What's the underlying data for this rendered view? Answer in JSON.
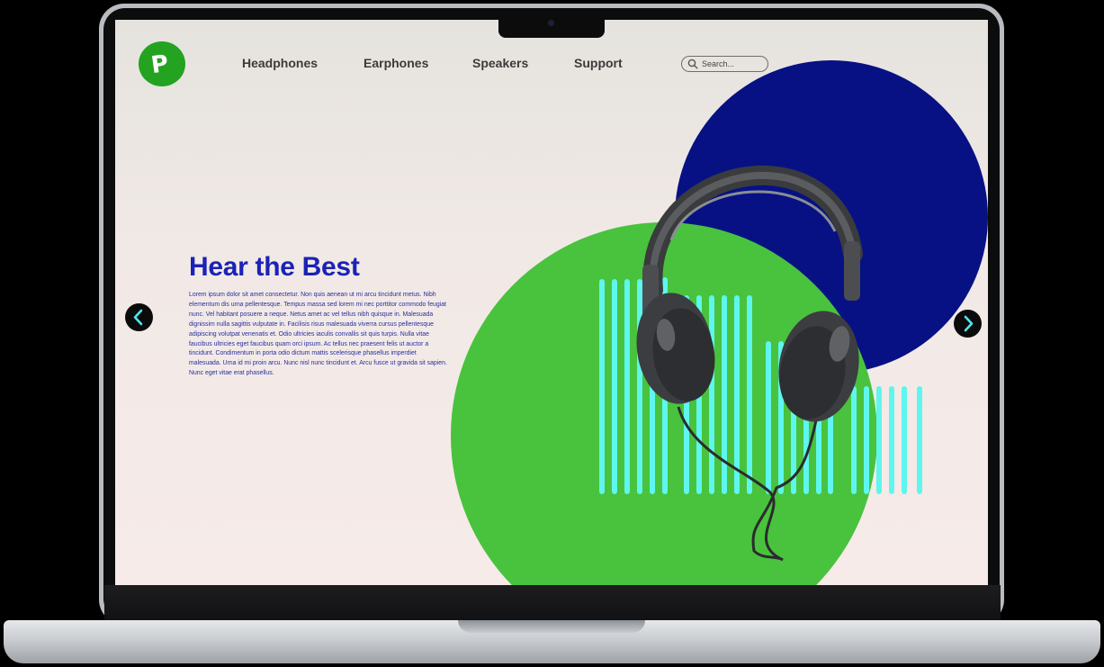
{
  "nav": {
    "logo_letter": "P",
    "items": [
      {
        "label": "Headphones"
      },
      {
        "label": "Earphones"
      },
      {
        "label": "Speakers"
      },
      {
        "label": "Support"
      }
    ],
    "search_placeholder": "Search..."
  },
  "hero": {
    "title": "Hear the Best",
    "body": "Lorem ipsum dolor sit amet consectetur. Non quis aenean ut mi arcu tincidunt metus. Nibh elementum dis urna pellentesque. Tempus massa sed lorem mi nec porttitor commodo feugiat nunc. Vel habitant posuere a neque. Netus amet ac vel tellus nibh quisque in. Malesuada dignissim nulla sagittis vulputate in. Facilisis risus malesuada viverra cursus pellentesque adipiscing volutpat venenatis et. Odio ultricies iaculis convallis sit quis turpis. Nulla vitae faucibus ultricies eget faucibus quam orci ipsum. Ac tellus nec praesent felis ut auctor a tincidunt. Condimentum in porta odio dictum mattis scelerisque phasellus imperdiet malesuada. Urna id mi proin arcu. Nunc nisl nunc tincidunt et. Arcu fusce ut gravida sit sapien. Nunc eget vitae erat phasellus."
  },
  "icons": {
    "logo": "p-logo-icon",
    "search": "search-icon",
    "prev": "chevron-left-icon",
    "next": "chevron-right-icon",
    "product": "headphones-icon"
  },
  "colors": {
    "brand_green": "#23a320",
    "circle_green": "#49c23e",
    "circle_navy": "#071184",
    "title_blue": "#1b22b6",
    "wave_cyan": "#5ef6ee",
    "arrow_cyan": "#4ee6f0",
    "laptop_frame": "#0c0c0c"
  }
}
